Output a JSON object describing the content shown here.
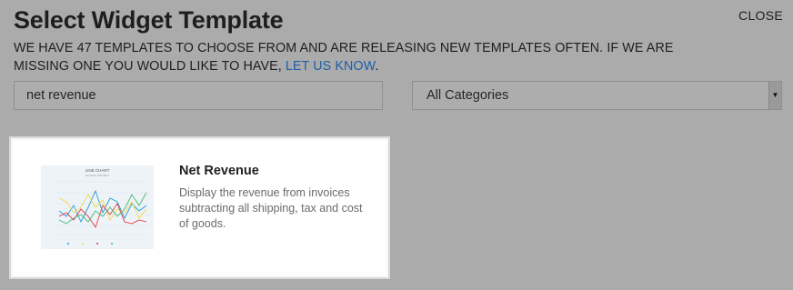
{
  "header": {
    "title": "Select Widget Template",
    "close_label": "CLOSE",
    "intro_text": "WE HAVE 47 TEMPLATES TO CHOOSE FROM AND ARE RELEASING NEW TEMPLATES OFTEN. IF WE ARE MISSING ONE YOU WOULD LIKE TO HAVE, ",
    "intro_link": "LET US KNOW",
    "intro_end": "."
  },
  "filters": {
    "search_value": "net revenue",
    "category_selected": "All Categories"
  },
  "results": [
    {
      "name": "Net Revenue",
      "description": "Display the revenue from invoices subtracting all shipping, tax and cost of goods.",
      "thumbnail": {
        "chart_title": "LINE CHART",
        "chart_subtitle": "SOURCE: PROJECT",
        "icon": "line-chart-thumbnail"
      }
    }
  ],
  "colors": {
    "overlay": "#ababab",
    "link": "#1d5fa8",
    "card_bg": "#ffffff",
    "series": [
      "#1f9bd6",
      "#f0d94a",
      "#e23b3b",
      "#46b878"
    ]
  }
}
